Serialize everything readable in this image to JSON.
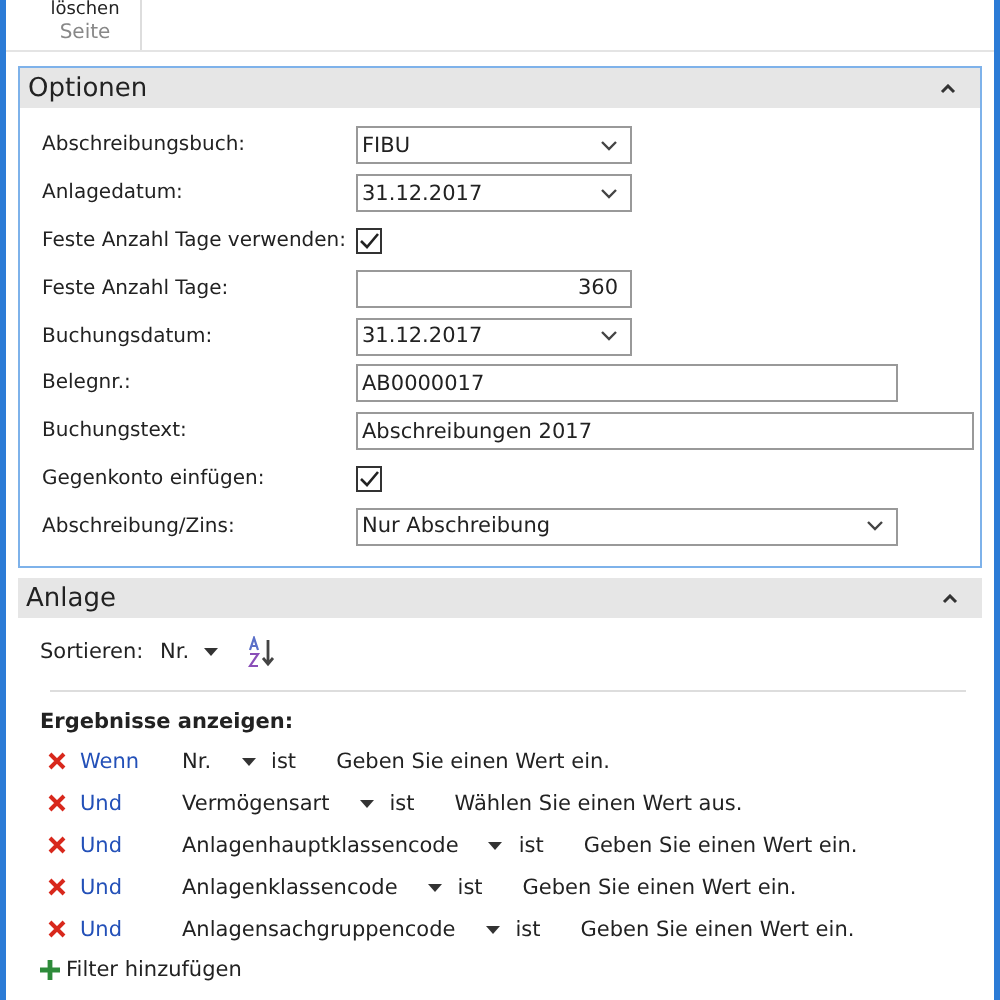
{
  "ribbon": {
    "button_label": "löschen",
    "group_label": "Seite"
  },
  "options": {
    "title": "Optionen",
    "expanded": true,
    "fields": [
      {
        "kind": "dropdown",
        "label": "Abschreibungsbuch:",
        "value": "FIBU"
      },
      {
        "kind": "dropdown",
        "label": "Anlagedatum:",
        "value": "31.12.2017"
      },
      {
        "kind": "checkbox",
        "label": "Feste Anzahl Tage verwenden:",
        "checked": true
      },
      {
        "kind": "number",
        "label": "Feste Anzahl Tage:",
        "value": "360"
      },
      {
        "kind": "dropdown",
        "label": "Buchungsdatum:",
        "value": "31.12.2017"
      },
      {
        "kind": "text",
        "label": "Belegnr.:",
        "value": "AB0000017"
      },
      {
        "kind": "text",
        "label": "Buchungstext:",
        "value": "Abschreibungen 2017"
      },
      {
        "kind": "checkbox",
        "label": "Gegenkonto einfügen:",
        "checked": true
      },
      {
        "kind": "dropdown",
        "label": "Abschreibung/Zins:",
        "value": "Nur Abschreibung"
      }
    ]
  },
  "asset": {
    "title": "Anlage",
    "expanded": true,
    "sort_label": "Sortieren:",
    "sort_field": "Nr.",
    "results_label": "Ergebnisse anzeigen:",
    "filters": [
      {
        "conjunction": "Wenn",
        "field": "Nr.",
        "operator": "ist",
        "placeholder": "Geben Sie einen Wert ein."
      },
      {
        "conjunction": "Und",
        "field": "Vermögensart",
        "operator": "ist",
        "placeholder": "Wählen Sie einen Wert aus."
      },
      {
        "conjunction": "Und",
        "field": "Anlagenhauptklassencode",
        "operator": "ist",
        "placeholder": "Geben Sie einen Wert ein."
      },
      {
        "conjunction": "Und",
        "field": "Anlagenklassencode",
        "operator": "ist",
        "placeholder": "Geben Sie einen Wert ein."
      },
      {
        "conjunction": "Und",
        "field": "Anlagensachgruppencode",
        "operator": "ist",
        "placeholder": "Geben Sie einen Wert ein."
      }
    ],
    "add_filter": "Filter hinzufügen"
  }
}
